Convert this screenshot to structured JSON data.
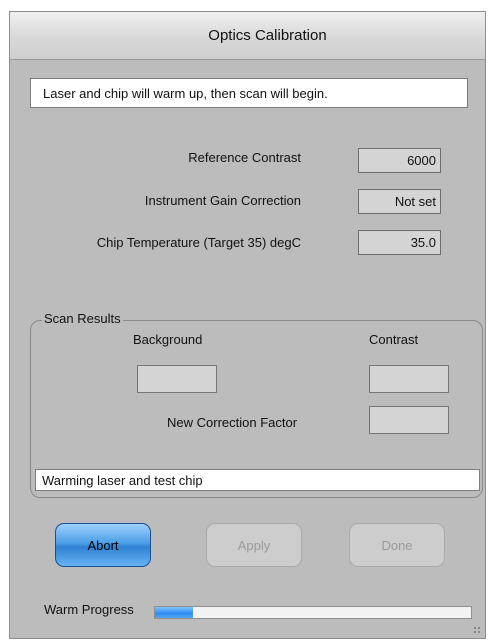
{
  "window": {
    "title": "Optics Calibration"
  },
  "info": {
    "message": "Laser and chip will warm up, then scan will begin."
  },
  "settings": [
    {
      "label": "Reference Contrast",
      "value": "6000"
    },
    {
      "label": "Instrument Gain Correction",
      "value": "Not set"
    },
    {
      "label": "Chip Temperature (Target 35) degC",
      "value": "35.0"
    }
  ],
  "scan_results": {
    "title": "Scan Results",
    "background_label": "Background",
    "contrast_label": "Contrast",
    "background_value": "",
    "contrast_value": "",
    "correction_label": "New Correction Factor",
    "correction_value": "",
    "status": "Warming laser and test chip"
  },
  "buttons": {
    "abort": "Abort",
    "apply": "Apply",
    "done": "Done"
  },
  "progress": {
    "label": "Warm Progress",
    "fraction": 0.12
  },
  "colors": {
    "window_bg": "#bcbcbc",
    "accent": "#2f82d2"
  }
}
